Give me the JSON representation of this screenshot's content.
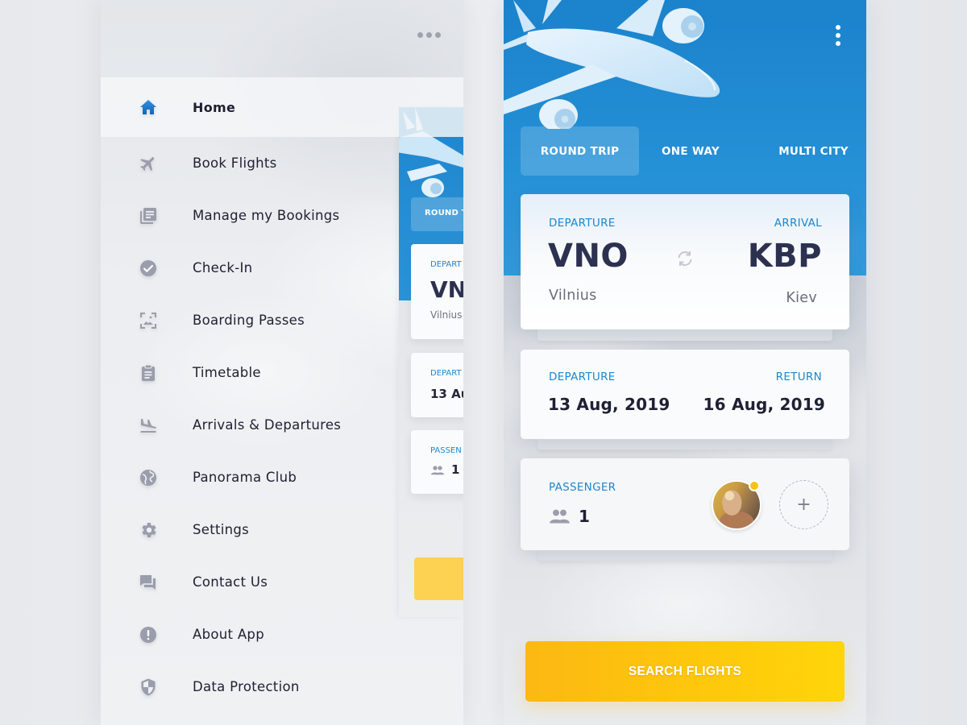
{
  "menu": {
    "more_icon": "more-horizontal-icon",
    "items": [
      {
        "label": "Home",
        "icon": "home-icon",
        "active": true
      },
      {
        "label": "Book Flights",
        "icon": "airplane-icon"
      },
      {
        "label": "Manage my Bookings",
        "icon": "library-books-icon"
      },
      {
        "label": "Check-In",
        "icon": "check-circle-icon"
      },
      {
        "label": "Boarding Passes",
        "icon": "image-frame-icon"
      },
      {
        "label": "Timetable",
        "icon": "clipboard-icon"
      },
      {
        "label": "Arrivals & Departures",
        "icon": "flight-land-icon"
      },
      {
        "label": "Panorama Club",
        "icon": "globe-icon"
      },
      {
        "label": "Settings",
        "icon": "gear-icon"
      },
      {
        "label": "Contact Us",
        "icon": "chat-bubbles-icon"
      },
      {
        "label": "About App",
        "icon": "alert-circle-icon"
      },
      {
        "label": "Data Protection",
        "icon": "shield-icon"
      }
    ]
  },
  "peek": {
    "tab": "ROUND T",
    "route_label": "DEPART",
    "route_code": "VN",
    "route_city": "Vilnius",
    "date_label": "DEPART",
    "date_value": "13 Au",
    "passenger_label": "PASSEN",
    "passenger_count": "1"
  },
  "booking": {
    "menu_icon": "more-vertical-icon",
    "trip_types": [
      {
        "label": "ROUND TRIP",
        "active": true
      },
      {
        "label": "ONE WAY",
        "active": false
      },
      {
        "label": "MULTI CITY",
        "active": false
      }
    ],
    "route": {
      "departure_label": "DEPARTURE",
      "arrival_label": "ARRIVAL",
      "from_code": "VNO",
      "from_city": "Vilnius",
      "to_code": "KBP",
      "to_city": "Kiev"
    },
    "dates": {
      "departure_label": "DEPARTURE",
      "return_label": "RETURN",
      "departure_date": "13 Aug, 2019",
      "return_date": "16 Aug, 2019"
    },
    "passengers": {
      "label": "PASSENGER",
      "count": "1",
      "add_symbol": "+"
    },
    "search_label": "SEARCH FLIGHTS"
  },
  "colors": {
    "accent_blue": "#1c87d0",
    "sky_blue": "#2490d6",
    "cta_yellow": "#fec60c",
    "text_dark": "#1e2032",
    "icon_gray": "#9a9dab",
    "status_dot": "#f6c312"
  }
}
